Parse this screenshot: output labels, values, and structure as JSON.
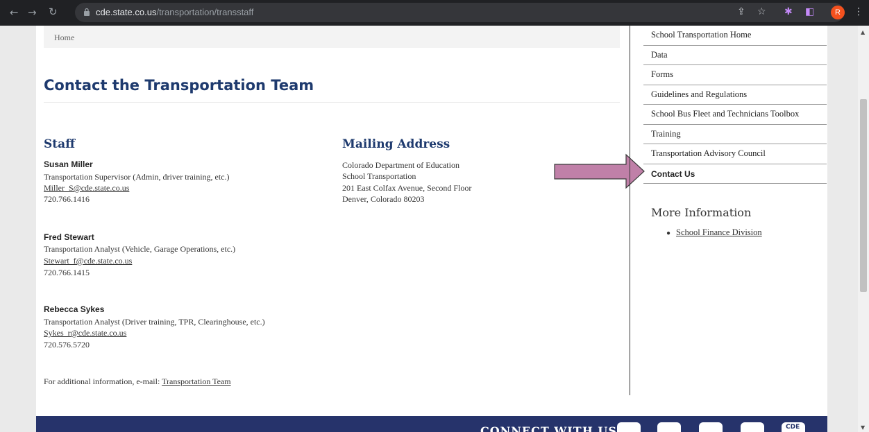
{
  "browser": {
    "url_host": "cde.state.co.us",
    "url_path": "/transportation/transstaff",
    "avatar_letter": "R",
    "icons": [
      "back-icon",
      "forward-icon",
      "reload-icon",
      "lock-icon",
      "share-icon",
      "star-icon",
      "extensions-icon",
      "sidepanel-icon",
      "menu-icon"
    ]
  },
  "breadcrumb": {
    "home": "Home"
  },
  "page": {
    "title": "Contact the Transportation Team"
  },
  "staff": {
    "heading": "Staff",
    "people": [
      {
        "name": "Susan Miller",
        "role": "Transportation Supervisor (Admin, driver training, etc.)",
        "email": "Miller_S@cde.state.co.us",
        "phone": "720.766.1416"
      },
      {
        "name": "Fred Stewart",
        "role": "Transportation Analyst  (Vehicle, Garage Operations, etc.)",
        "email": "Stewart_f@cde.state.co.us",
        "phone": "720.766.1415"
      },
      {
        "name": "Rebecca Sykes",
        "role": "Transportation Analyst (Driver training, TPR, Clearinghouse, etc.)",
        "email": "Sykes_r@cde.state.co.us",
        "phone": "720.576.5720"
      }
    ],
    "additional_prefix": "For additional information, e-mail: ",
    "additional_link": "Transportation Team"
  },
  "mailing": {
    "heading": "Mailing Address",
    "lines": [
      "Colorado Department of Education",
      "School Transportation",
      "201 East Colfax Avenue, Second Floor",
      "Denver, Colorado 80203"
    ]
  },
  "sidebar": {
    "items": [
      {
        "label": "School Transportation Home"
      },
      {
        "label": "Data"
      },
      {
        "label": "Forms"
      },
      {
        "label": "Guidelines and Regulations"
      },
      {
        "label": "School Bus Fleet and Technicians Toolbox"
      },
      {
        "label": "Training"
      },
      {
        "label": "Transportation Advisory Council"
      },
      {
        "label": "Contact Us"
      }
    ],
    "active_index": 7,
    "more_title": "More Information",
    "more_link": "School Finance Division"
  },
  "footer": {
    "connect": "CONNECT WITH US",
    "social_text": "CDE"
  },
  "colors": {
    "title": "#1e3a6e",
    "footer": "#26336b",
    "arrow": "#c080a8",
    "chrome": "#202124"
  }
}
